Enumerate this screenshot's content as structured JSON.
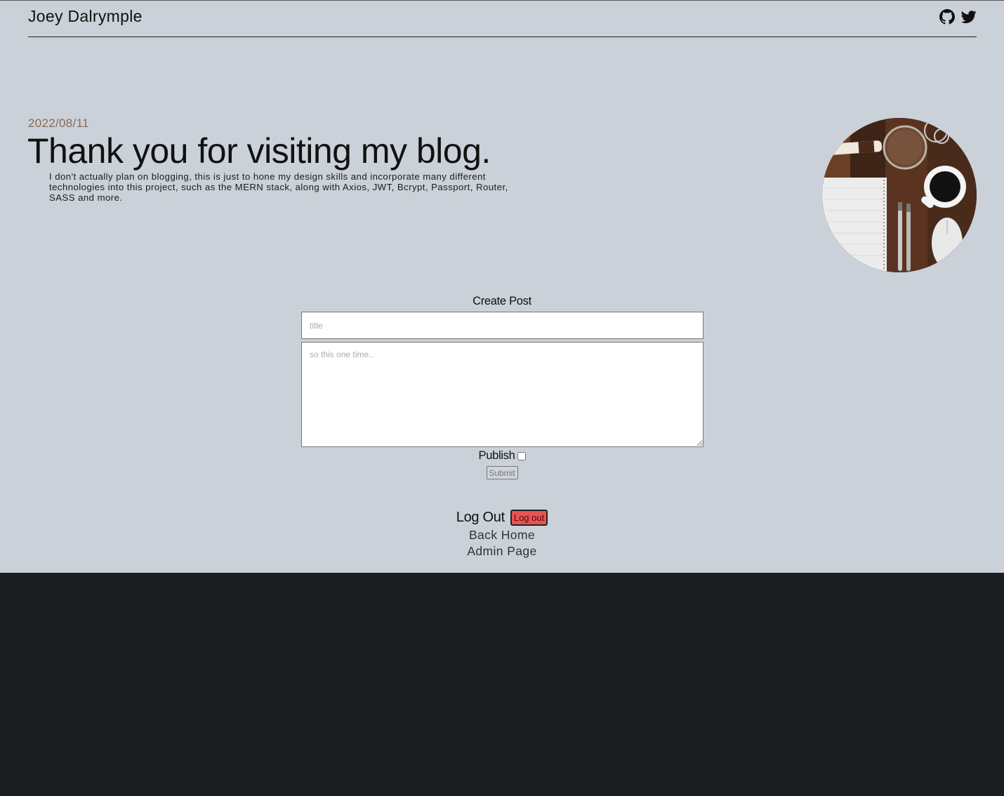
{
  "header": {
    "site_name": "Joey Dalrymple",
    "social_icons": [
      "github-icon",
      "twitter-icon"
    ]
  },
  "hero": {
    "date": "2022/08/11",
    "title": "Thank you for visiting my blog.",
    "text": "I don't actually plan on blogging, this is just to hone my design skills and incorporate many different technologies into this project, such as the MERN stack, along with Axios, JWT, Bcrypt, Passport, Router, SASS and more.",
    "image": "desk-photo"
  },
  "create_post": {
    "heading": "Create Post",
    "title_placeholder": "title",
    "title_value": "",
    "body_placeholder": "so this one time..",
    "body_value": "",
    "publish_label": "Publish",
    "publish_checked": false,
    "submit_label": "Submit"
  },
  "account": {
    "logout_label": "Log Out",
    "logout_button": "Log out",
    "back_home": "Back Home",
    "admin_page": "Admin Page"
  },
  "colors": {
    "page_background": "#cad1d8",
    "footer_background": "#1b1e21",
    "date_color": "#8a6a55",
    "logout_button": "#ec5252"
  }
}
